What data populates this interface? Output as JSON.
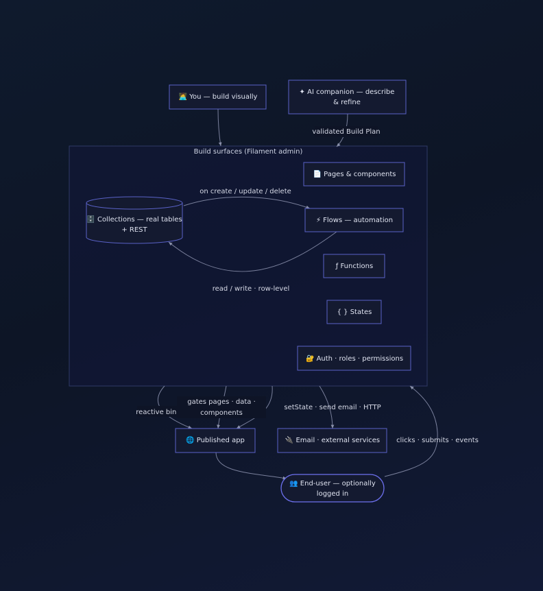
{
  "cluster": {
    "title": "Build surfaces (Filament admin)"
  },
  "nodes": {
    "you": "🧑‍💻 You — build visually",
    "ai_line1": "✦ AI companion — describe",
    "ai_line2": "& refine",
    "pages": "📄 Pages & components",
    "collections_line1": "🗄️ Collections — real tables",
    "collections_line2": "+ REST",
    "flows": "⚡ Flows — automation",
    "functions": "ƒ Functions",
    "states": "{ } States",
    "auth": "🔐 Auth · roles · permissions",
    "published": "🌐 Published app",
    "email": "🔌 Email · external services",
    "enduser_line1": "👥 End-user — optionally",
    "enduser_line2": "logged in"
  },
  "edges": {
    "validated": "validated Build Plan",
    "on_create": "on create / update / delete",
    "read_write": "read / write · row-level",
    "reactive": "reactive bind",
    "gates_line1": "gates pages · data ·",
    "gates_line2": "components",
    "setstate": "setState · send email · HTTP",
    "clicks": "clicks · submits · events"
  }
}
